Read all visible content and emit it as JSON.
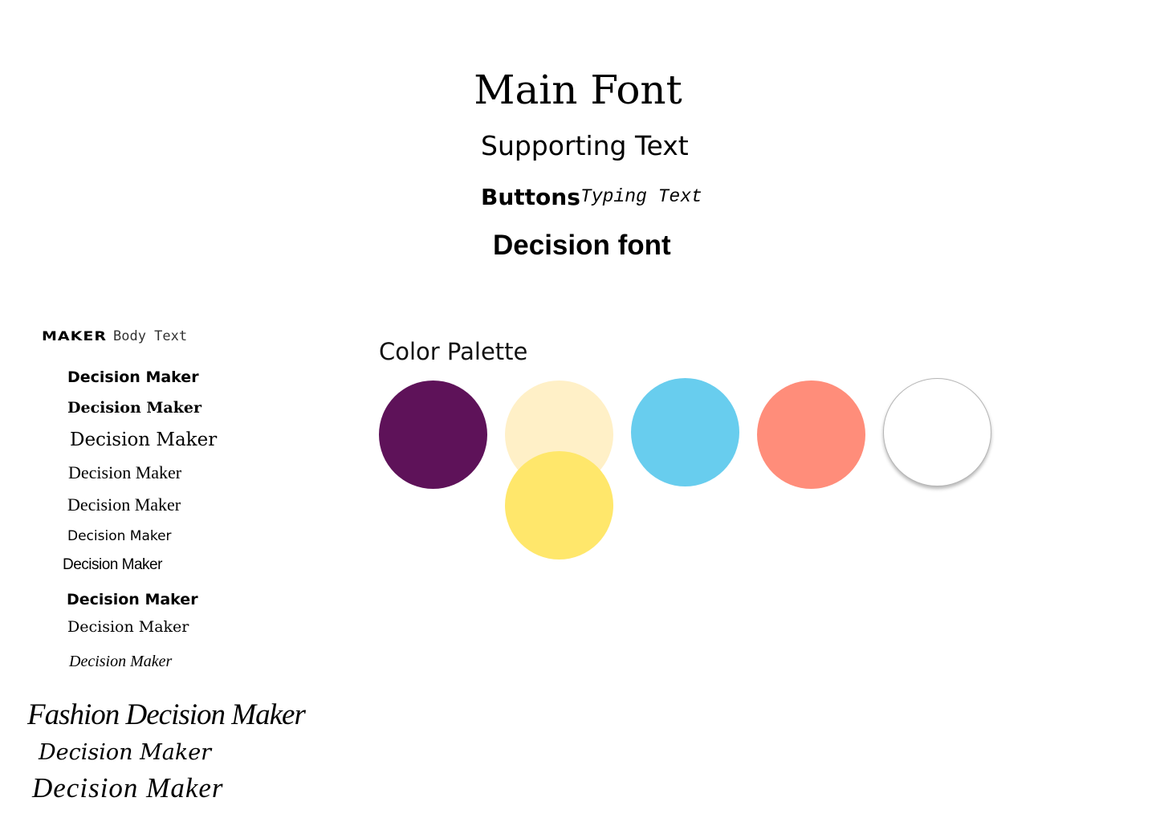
{
  "fonts": {
    "main": "Main Font",
    "supporting": "Supporting Text",
    "buttons": "Buttons",
    "typing": "Typing Text",
    "decision": "Decision font"
  },
  "samples": {
    "maker": "MAKER",
    "body_text": "Body Text",
    "decision_maker": [
      "Decision Maker",
      "Decision Maker",
      "Decision Maker",
      "Decision Maker",
      "Decision Maker",
      "Decision Maker",
      "Decision Maker",
      "Decision Maker",
      "Decision Maker",
      "Decision Maker"
    ],
    "script": [
      "Fashion Decision Maker",
      "Decision Maker",
      "Decision Maker"
    ]
  },
  "palette": {
    "title": "Color Palette",
    "colors": {
      "purple": "#5E1259",
      "cream": "#FFF0C7",
      "yellow": "#FFE76B",
      "blue": "#68CDEE",
      "coral": "#FF8D7A",
      "white": "#FFFFFF"
    }
  }
}
